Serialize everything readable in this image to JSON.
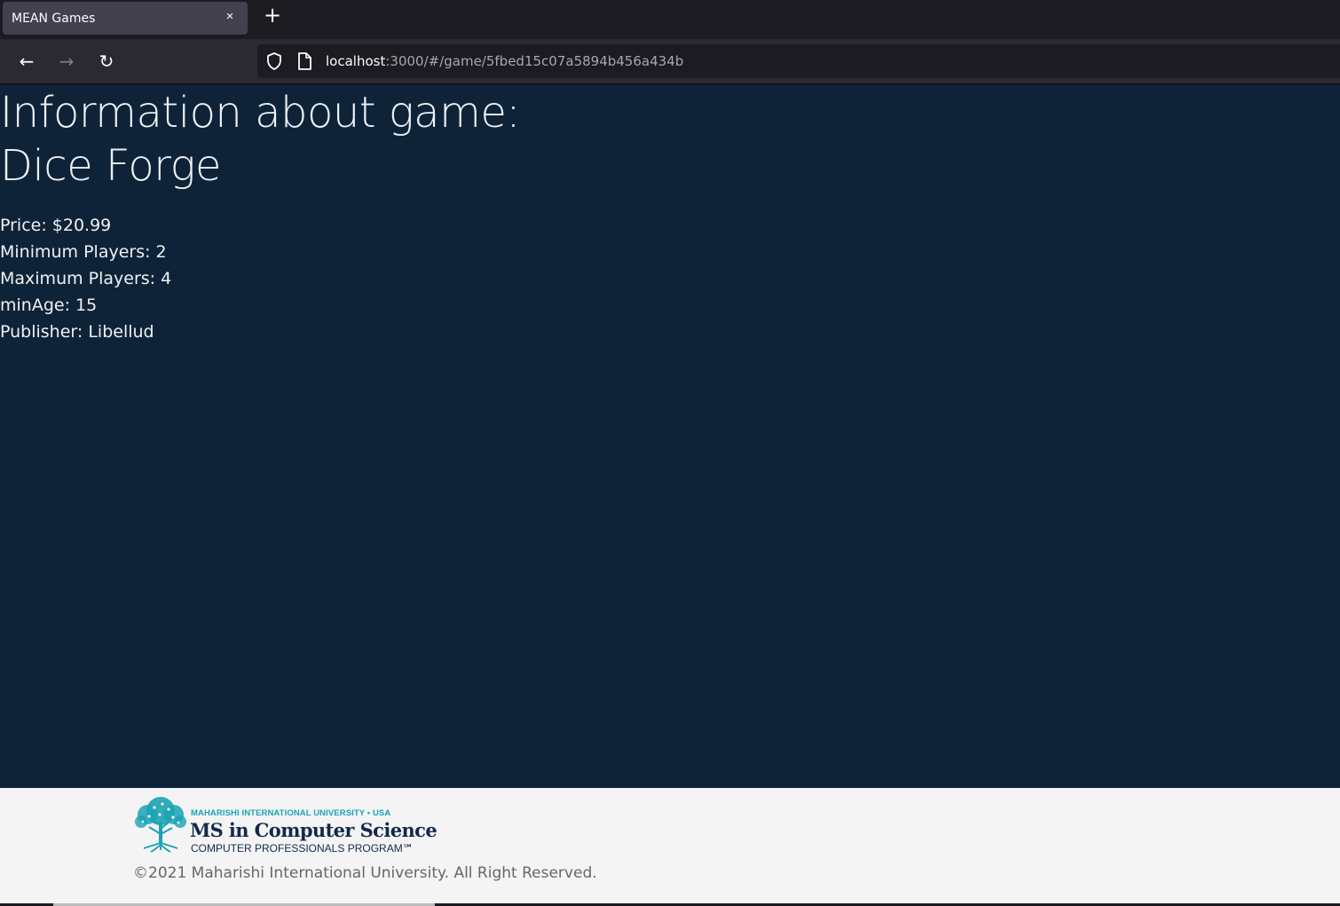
{
  "browser": {
    "tab": {
      "title": "MEAN Games",
      "close_glyph": "×"
    },
    "new_tab_glyph": "+",
    "nav": {
      "back_glyph": "←",
      "forward_glyph": "→",
      "reload_glyph": "↻"
    },
    "url": {
      "host": "localhost",
      "path": ":3000/#/game/5fbed15c07a5894b456a434b"
    }
  },
  "page": {
    "heading_line1": "Information about game:",
    "heading_line2": "Dice Forge",
    "details": [
      "Price: $20.99",
      "Minimum Players: 2",
      "Maximum Players: 4",
      "minAge: 15",
      "Publisher: Libellud"
    ]
  },
  "footer": {
    "logo": {
      "small": "MAHARISHI INTERNATIONAL UNIVERSITY • USA",
      "main": "MS in Computer Science",
      "sub": "COMPUTER PROFESSIONALS PROGRAM℠"
    },
    "copyright": "©2021 Maharishi International University. All Right Reserved."
  },
  "colors": {
    "page_bg": "#0f2338",
    "footer_bg": "#f4f4f4",
    "logo_teal": "#1aa3b3",
    "logo_navy": "#13294b"
  },
  "icons": [
    "close-icon",
    "plus-icon",
    "back-arrow-icon",
    "forward-arrow-icon",
    "reload-icon",
    "shield-icon",
    "page-icon",
    "tree-logo-icon"
  ]
}
